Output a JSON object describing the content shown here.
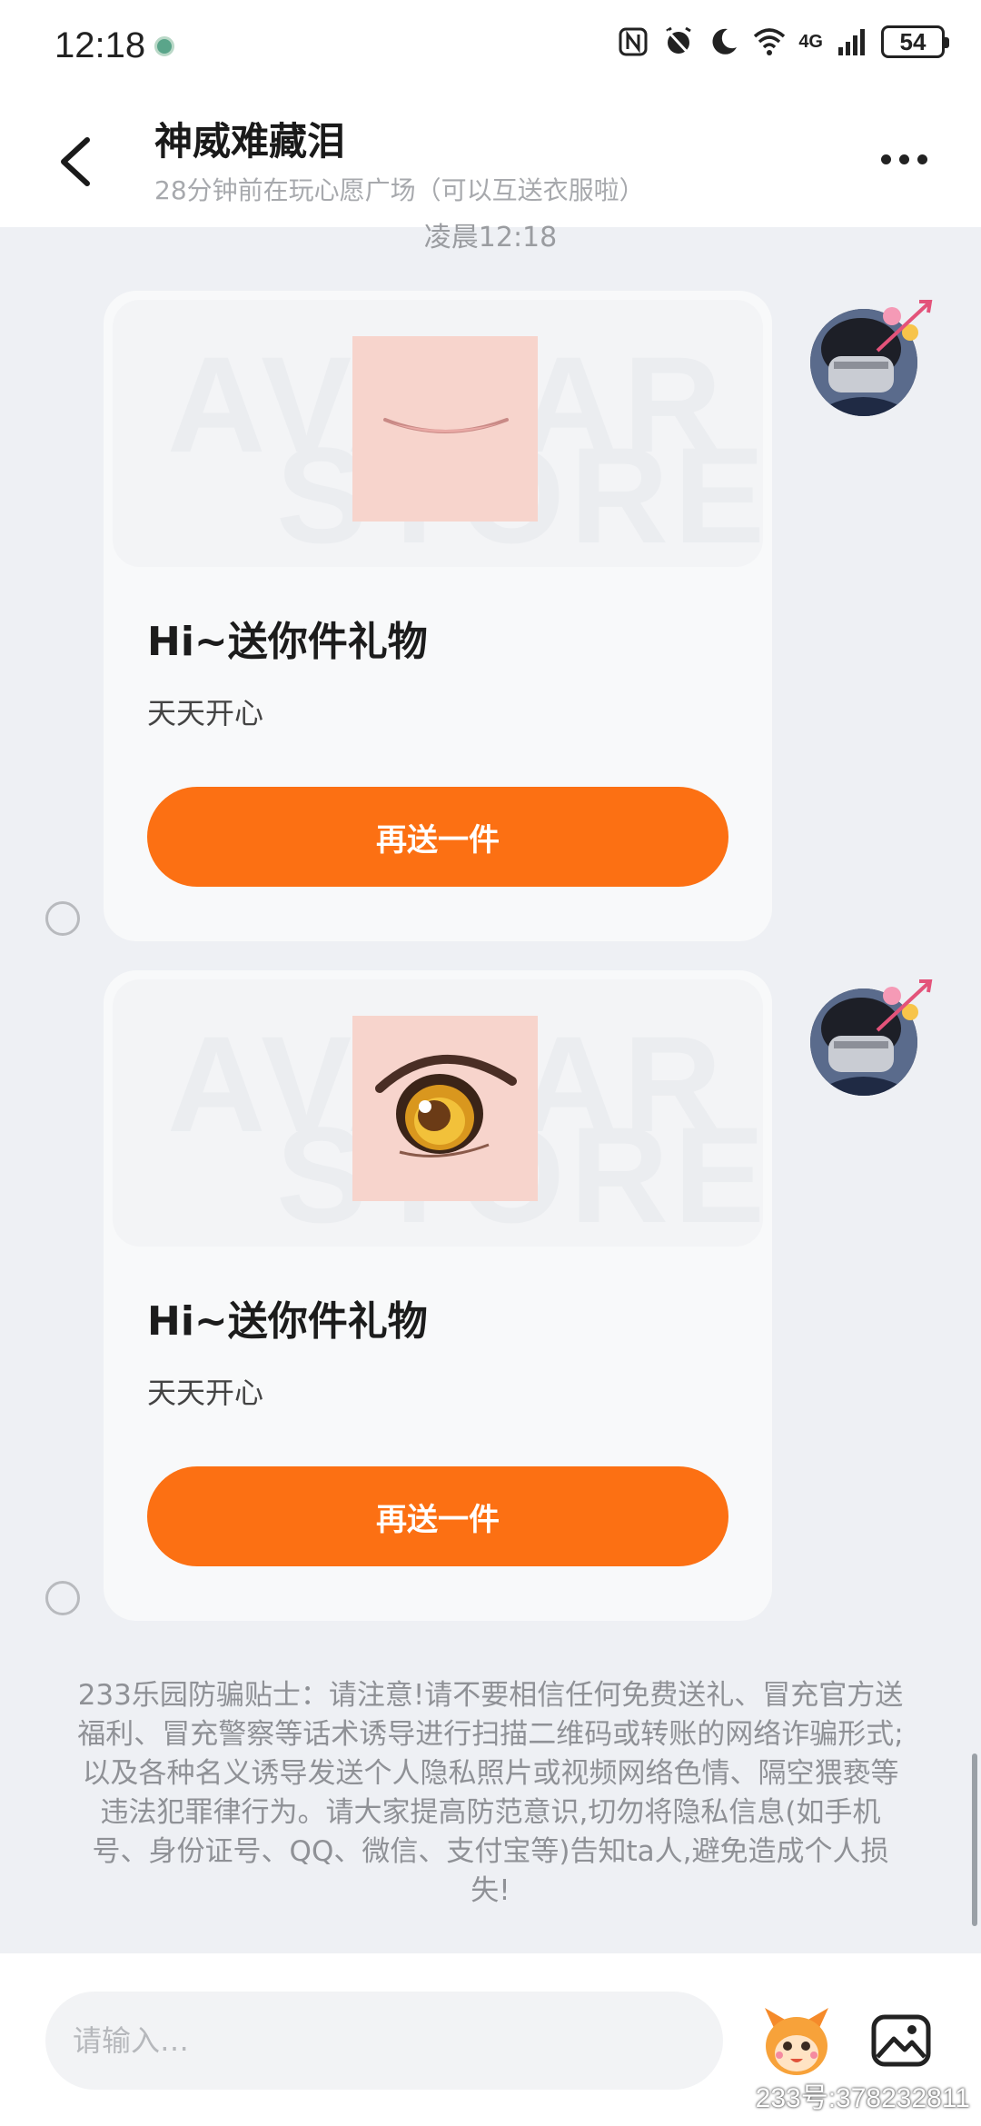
{
  "status_bar": {
    "time": "12:18",
    "network": "4G",
    "battery": "54"
  },
  "header": {
    "title": "神威难藏泪",
    "subtitle": "28分钟前在玩心愿广场（可以互送衣服啦）"
  },
  "messages": {
    "timestamp": "凌晨12:18",
    "gift_cards": [
      {
        "title": "Hi~送你件礼物",
        "message": "天天开心",
        "button_label": "再送一件",
        "item": "mouth"
      },
      {
        "title": "Hi~送你件礼物",
        "message": "天天开心",
        "button_label": "再送一件",
        "item": "eye"
      }
    ],
    "watermark_text": "AVATAR STORE"
  },
  "safety_tip": "233乐园防骗贴士：请注意!请不要相信任何免费送礼、冒充官方送福利、冒充警察等话术诱导进行扫描二维码或转账的网络诈骗形式;以及各种名义诱导发送个人隐私照片或视频网络色情、隔空猥亵等违法犯罪律行为。请大家提高防范意识,切勿将隐私信息(如手机号、身份证号、QQ、微信、支付宝等)告知ta人,避免造成个人损失!",
  "input": {
    "placeholder": "请输入…"
  },
  "account_id": "233号:378232811",
  "colors": {
    "accent": "#fc7013",
    "background": "#eef0f4",
    "card": "#f8f9fa"
  }
}
